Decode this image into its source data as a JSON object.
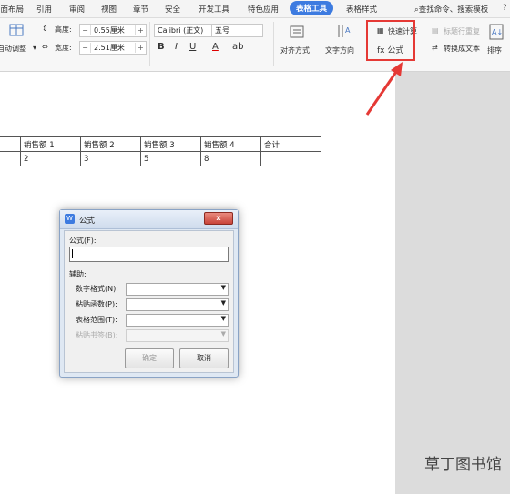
{
  "menubar": {
    "items": [
      "页面布局",
      "引用",
      "审阅",
      "视图",
      "章节",
      "安全",
      "开发工具",
      "特色应用",
      "表格工具",
      "表格样式"
    ],
    "search": "查找命令、搜索模板",
    "help": "?"
  },
  "ribbon": {
    "autofit_label": "自动调整",
    "height_label": "高度:",
    "height_value": "0.55厘米",
    "width_label": "宽度:",
    "width_value": "2.51厘米",
    "font_name": "Calibri (正文)",
    "font_size": "五号",
    "bold": "B",
    "italic": "I",
    "underline": "U",
    "font_color": "A",
    "highlight": "ab",
    "align_label": "对齐方式",
    "text_dir_label": "文字方向",
    "quick_calc_label": "快速计算",
    "title_repeat_label": "标题行重复",
    "formula_label": "fx 公式",
    "convert_label": "转换成文本",
    "sort_label": "排序"
  },
  "table": {
    "header": [
      "",
      "销售额 1",
      "销售额 2",
      "销售额 3",
      "销售额 4",
      "合计"
    ],
    "row": [
      "",
      "2",
      "3",
      "5",
      "8",
      ""
    ]
  },
  "dialog": {
    "title": "公式",
    "close": "x",
    "formula_label": "公式(F):",
    "formula_value": "",
    "aux_label": "辅助:",
    "number_format_label": "数字格式(N):",
    "paste_function_label": "粘贴函数(P):",
    "table_range_label": "表格范围(T):",
    "paste_bookmark_label": "粘贴书签(B):",
    "ok_label": "确定",
    "cancel_label": "取消"
  },
  "watermark": "草丁图书馆",
  "colors": {
    "accent": "#3d7be0",
    "highlight_box": "#e53935"
  }
}
